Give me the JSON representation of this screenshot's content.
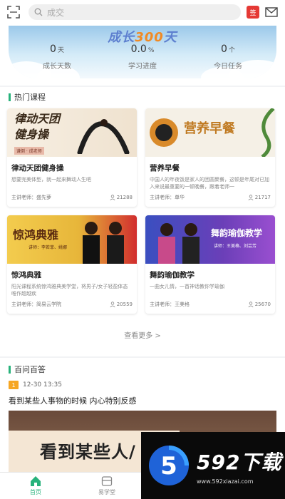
{
  "header": {
    "search_placeholder": "成交",
    "sign_badge": "签"
  },
  "stats": {
    "banner_title_a": "成长",
    "banner_title_b": "300",
    "banner_title_c": "天",
    "items": [
      {
        "num": "0",
        "unit": "天",
        "label": "成长天数"
      },
      {
        "num": "0.0",
        "unit": "%",
        "label": "学习进度"
      },
      {
        "num": "0",
        "unit": "个",
        "label": "今日任务"
      }
    ]
  },
  "courses": {
    "section_title": "热门课程",
    "cards": [
      {
        "thumb_text": "律动天团\n健身操",
        "thumb_sub": "谦倒 · 成老师",
        "title": "律动天团健身操",
        "desc": "想要完美体型，就一起来舞动人生吧",
        "teacher": "主讲老师：盛先萝",
        "count": "21288"
      },
      {
        "thumb_text": "营养早餐",
        "title": "营养早餐",
        "desc": "中国人的年夜饭是家人的团圆聚餐，这顿是年尾对已加入来说最重要的一顿晚餐，跟着老师一",
        "teacher": "主讲老师：单华",
        "count": "21717"
      },
      {
        "thumb_text": "惊鸿典雅",
        "thumb_sub": "讲师：李若菲、姚娜",
        "title": "惊鸿典雅",
        "desc": "阳光课程系统惊鸿雅典美学堂，将男子/女子轻盈体态唯作超越疾",
        "teacher": "主讲老师：简易云学院",
        "count": "20559"
      },
      {
        "thumb_text": "舞韵瑜伽教学",
        "thumb_sub": "讲师：王美格、刘芸芳",
        "title": "舞韵瑜伽教学",
        "desc": "一曲女儿情，一首神话教你学瑜伽",
        "teacher": "主讲老师：王美格",
        "count": "25670"
      }
    ],
    "more": "查看更多 >"
  },
  "qa": {
    "section_title": "百问百答",
    "badge": "1",
    "time": "12-30 13:35",
    "question": "看到某些人事物的时候 内心特别反感",
    "image_text": "看到某些人/"
  },
  "tabs": [
    {
      "label": "首页",
      "icon": "home-icon"
    },
    {
      "label": "易学堂",
      "icon": "classroom-icon"
    },
    {
      "label": "",
      "icon": ""
    },
    {
      "label": "",
      "icon": ""
    }
  ],
  "watermark": {
    "brand": "592下载",
    "url": "www.592xiazai.com"
  },
  "colors": {
    "accent": "#27b27b",
    "badge_red": "#e53935",
    "qa_badge": "#f6a623"
  }
}
